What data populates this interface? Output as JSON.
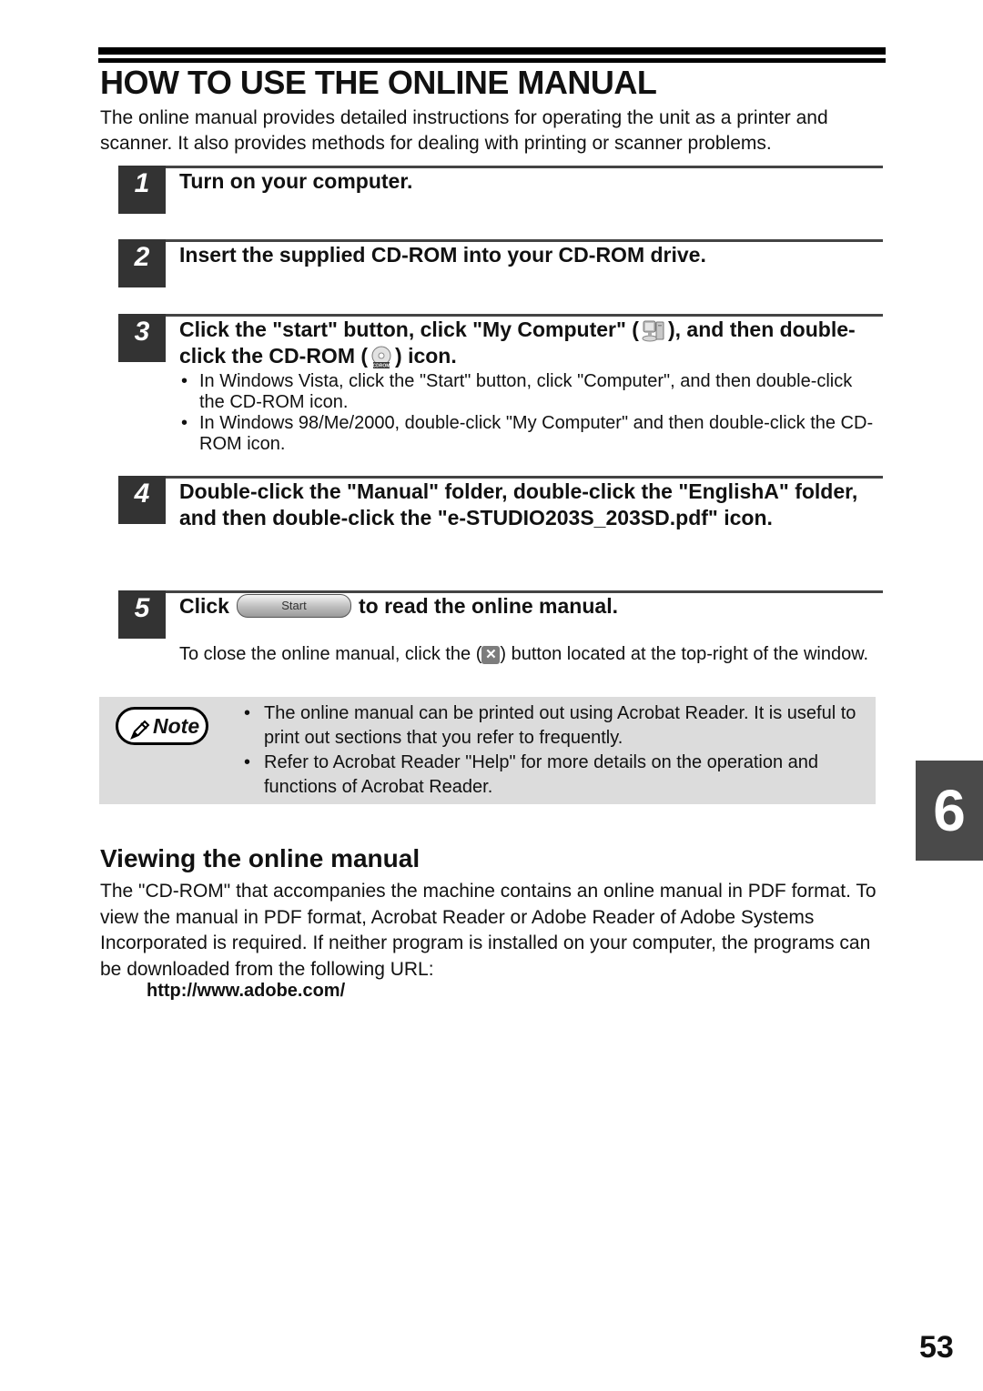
{
  "header": {
    "title": "HOW TO USE THE ONLINE MANUAL",
    "intro": "The online manual provides detailed instructions for operating the unit as a printer and scanner. It also provides methods for dealing with printing or scanner problems."
  },
  "steps": [
    {
      "number": "1",
      "text": "Turn on your computer."
    },
    {
      "number": "2",
      "text": "Insert the supplied CD-ROM into your CD-ROM drive."
    },
    {
      "number": "3",
      "text_a": "Click the \"start\" button, click \"My Computer\" (",
      "icon_a": "my-computer-icon",
      "text_b": "), and then double-click the CD-ROM (",
      "icon_b": "cd-rom-icon",
      "icon_b_label": "CDROM",
      "text_c": ") icon.",
      "bullets": [
        "In Windows Vista, click the \"Start\" button, click \"Computer\", and then double-click the CD-ROM icon.",
        "In Windows 98/Me/2000, double-click \"My Computer\" and then double-click the CD-ROM icon."
      ]
    },
    {
      "number": "4",
      "text": "Double-click the \"Manual\" folder, double-click the \"EnglishA\" folder, and then double-click the \"e-STUDIO203S_203SD.pdf\" icon."
    },
    {
      "number": "5",
      "text_a": "Click",
      "button_label": "Start",
      "text_b": "to read the online manual.",
      "note_a": "To close the online manual, click the (",
      "close_icon": "close-x-icon",
      "note_b": ") button located at the top-right of the window."
    }
  ],
  "note": {
    "badge": "Note",
    "items": [
      "The online manual can be printed out using Acrobat Reader. It is useful to print out sections that you refer to frequently.",
      "Refer to Acrobat Reader \"Help\" for more details on the operation and functions of Acrobat Reader."
    ]
  },
  "section": {
    "title": "Viewing the online manual",
    "body": "The \"CD-ROM\" that accompanies the machine contains an online manual in PDF format. To view the manual in PDF format, Acrobat Reader or Adobe Reader of Adobe Systems Incorporated is required. If neither program is installed on your computer, the programs can be downloaded from the following URL:",
    "url": "http://www.adobe.com/"
  },
  "chapter_tab": "6",
  "page_number": "53",
  "colors": {
    "step_number_bg": "#333333",
    "note_bg": "#dcdcdc",
    "chapter_tab_bg": "#4a4a4a"
  }
}
